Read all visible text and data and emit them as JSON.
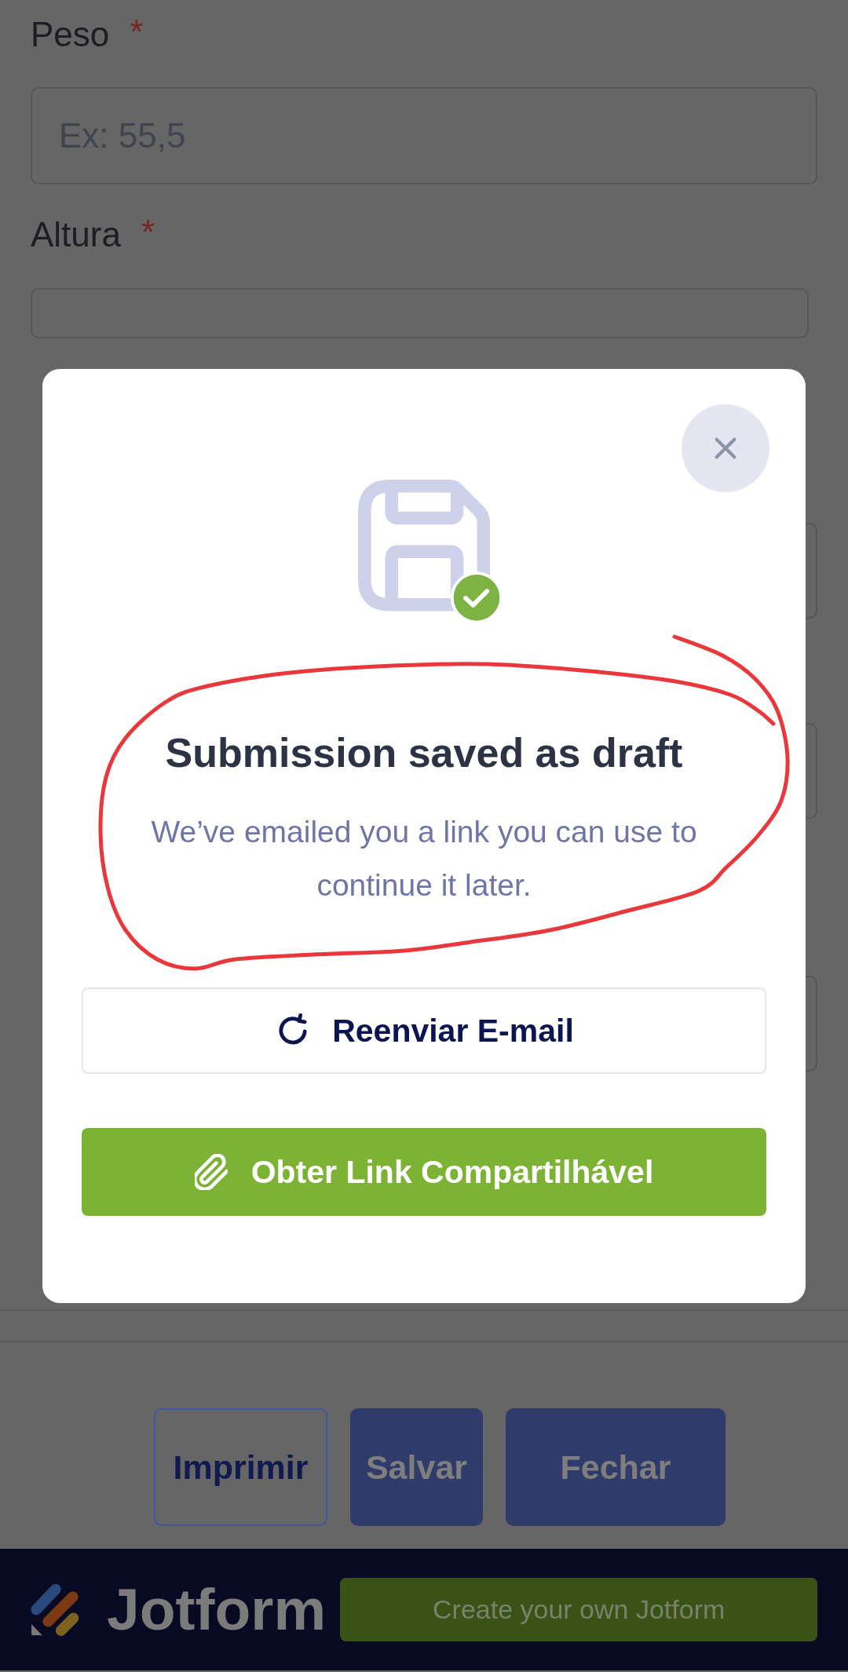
{
  "form": {
    "fields": [
      {
        "kind": "labeled",
        "label": "Peso",
        "required_mark": "*",
        "placeholder": "Ex: 55,5"
      },
      {
        "kind": "labeled",
        "label": "Altura",
        "required_mark": "*"
      },
      {
        "kind": "covered"
      },
      {
        "kind": "covered"
      },
      {
        "kind": "covered"
      }
    ]
  },
  "actions": [
    {
      "kind": "outline",
      "label": "Imprimir"
    },
    {
      "kind": "filled",
      "label": "Salvar"
    },
    {
      "kind": "filled",
      "label": "Fechar"
    }
  ],
  "footer": {
    "brand": "Jotform",
    "cta": "Create your own Jotform"
  },
  "dialog": {
    "title": "Submission saved as draft",
    "message": "We’ve emailed you a link you can use to continue it later.",
    "buttons": [
      {
        "kind": "resend",
        "label": "Reenviar E-mail"
      },
      {
        "kind": "share",
        "label": "Obter Link Compartilhável"
      }
    ]
  },
  "annotation": {
    "kind": "freehand-loop"
  }
}
